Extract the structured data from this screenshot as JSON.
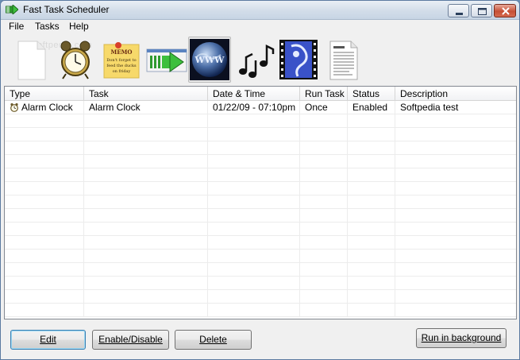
{
  "window": {
    "title": "Fast Task Scheduler"
  },
  "menu": {
    "items": [
      "File",
      "Tasks",
      "Help"
    ]
  },
  "watermark": "softpedia.com",
  "toolbar": {
    "tools": [
      {
        "icon": "blank-document-icon"
      },
      {
        "icon": "alarm-clock-icon"
      },
      {
        "icon": "memo-note-icon",
        "text": "MEMO\nDon't forget to feed the ducks on friday"
      },
      {
        "icon": "open-program-icon"
      },
      {
        "icon": "web-globe-icon",
        "text": "WWW",
        "active": true
      },
      {
        "icon": "music-notes-icon"
      },
      {
        "icon": "video-film-icon"
      },
      {
        "icon": "text-document-icon"
      }
    ]
  },
  "grid": {
    "columns": [
      "Type",
      "Task",
      "Date & Time",
      "Run Task",
      "Status",
      "Description"
    ],
    "rows": [
      {
        "type": "Alarm Clock",
        "task": "Alarm Clock",
        "datetime": "01/22/09 - 07:10pm",
        "run": "Once",
        "status": "Enabled",
        "description": "Softpedia test"
      }
    ]
  },
  "buttons": {
    "edit": "Edit",
    "enable_disable": "Enable/Disable",
    "delete": "Delete",
    "run_background": "Run in background"
  }
}
